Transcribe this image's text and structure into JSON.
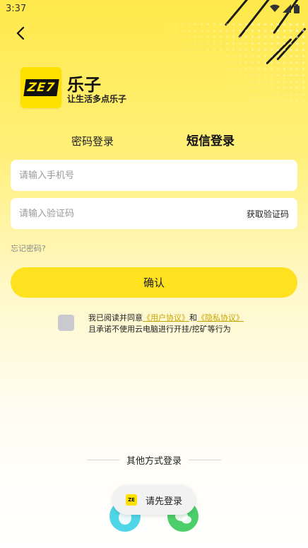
{
  "status_bar": {
    "time": "3:37"
  },
  "brand": {
    "name": "乐子",
    "slogan": "让生活多点乐子",
    "logo_text": "ZE7"
  },
  "tabs": [
    {
      "label": "密码登录",
      "active": false
    },
    {
      "label": "短信登录",
      "active": true
    }
  ],
  "form": {
    "phone_placeholder": "请输入手机号",
    "code_placeholder": "请输入验证码",
    "get_code_label": "获取验证码",
    "forgot_label": "忘记密码?",
    "confirm_label": "确认"
  },
  "agreement": {
    "prefix": "我已阅读并同意",
    "user_agreement": "《用户协议》",
    "and": "和",
    "privacy_agreement": "《隐私协议》",
    "line2": "且承诺不使用云电脑进行开挂/挖矿等行为"
  },
  "other_login": {
    "label": "其他方式登录"
  },
  "toast": {
    "text": "请先登录",
    "icon_text": "ZE"
  },
  "colors": {
    "accent": "#ffe21f",
    "link": "#c9a400",
    "qq": "#4fd6e6",
    "wechat": "#4ccf6a"
  }
}
